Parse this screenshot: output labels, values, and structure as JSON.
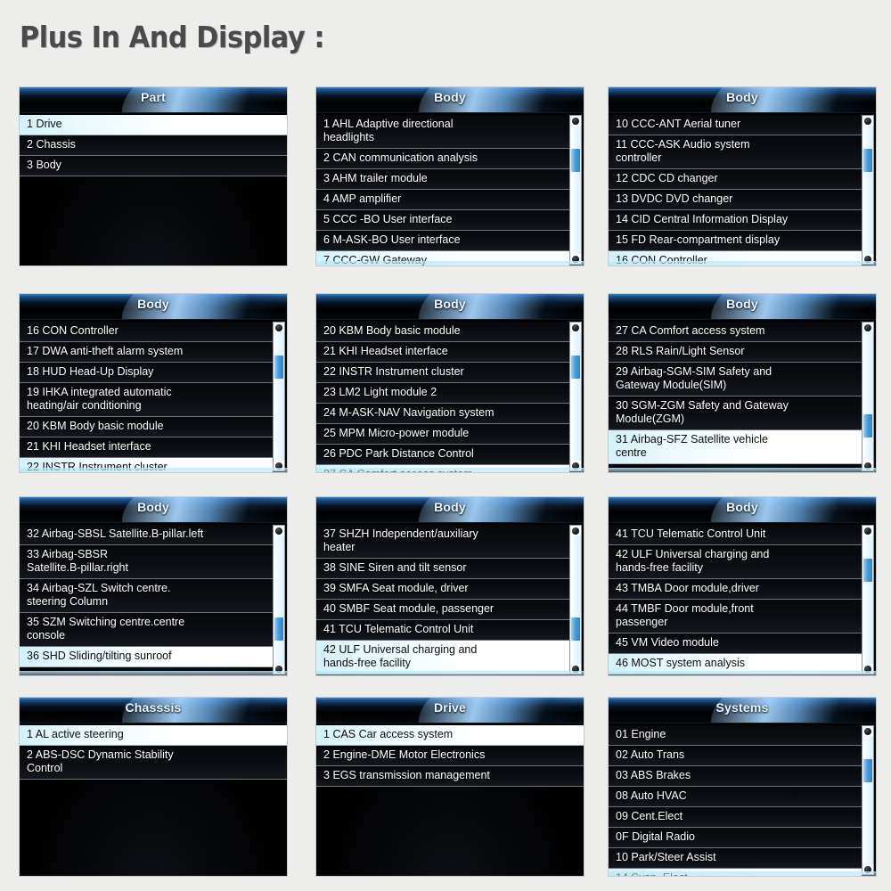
{
  "page": {
    "title": "Plus In And Display :",
    "background_color": "#ededec",
    "accent_color": "#4b9ede",
    "selected_row_color": "#e7f8fc",
    "header_glow_color": "#3d85c8"
  },
  "screens": [
    {
      "header": "Part",
      "scrollbar": {
        "visible": false,
        "thumb_top_pct": 0,
        "thumb_height_pct": 0
      },
      "bottom_sheen": false,
      "items": [
        {
          "num": "1",
          "label": "Drive",
          "selected": true
        },
        {
          "num": "2",
          "label": "Chassis",
          "selected": false
        },
        {
          "num": "3",
          "label": "Body",
          "selected": false
        }
      ]
    },
    {
      "header": "Body",
      "scrollbar": {
        "visible": true,
        "thumb_top_pct": 22,
        "thumb_height_pct": 16
      },
      "bottom_sheen": true,
      "items": [
        {
          "num": "1",
          "label": "AHL Adaptive directional\nheadlights",
          "selected": false
        },
        {
          "num": "2",
          "label": "CAN communication analysis",
          "selected": false
        },
        {
          "num": "3",
          "label": "AHM trailer module",
          "selected": false
        },
        {
          "num": "4",
          "label": "AMP amplifier",
          "selected": false
        },
        {
          "num": "5",
          "label": "CCC -BO User interface",
          "selected": false
        },
        {
          "num": "6",
          "label": "M-ASK-BO User interface",
          "selected": false
        },
        {
          "num": "7",
          "label": "CCC-GW Gateway",
          "selected": true
        }
      ]
    },
    {
      "header": "Body",
      "scrollbar": {
        "visible": true,
        "thumb_top_pct": 22,
        "thumb_height_pct": 16
      },
      "bottom_sheen": true,
      "items": [
        {
          "num": "10",
          "label": "CCC-ANT Aerial tuner",
          "selected": false
        },
        {
          "num": "11",
          "label": "CCC-ASK Audio system\ncontroller",
          "selected": false
        },
        {
          "num": "12",
          "label": "CDC CD changer",
          "selected": false
        },
        {
          "num": "13",
          "label": "DVDC DVD changer",
          "selected": false
        },
        {
          "num": "14",
          "label": "CID Central Information Display",
          "selected": false
        },
        {
          "num": "15",
          "label": "FD Rear-compartment display",
          "selected": false
        },
        {
          "num": "16",
          "label": "CON Controller",
          "selected": true
        }
      ]
    },
    {
      "header": "Body",
      "scrollbar": {
        "visible": true,
        "thumb_top_pct": 22,
        "thumb_height_pct": 16
      },
      "bottom_sheen": true,
      "items": [
        {
          "num": "16",
          "label": "CON Controller",
          "selected": false
        },
        {
          "num": "17",
          "label": "DWA anti-theft alarm system",
          "selected": false
        },
        {
          "num": "18",
          "label": "HUD Head-Up Display",
          "selected": false
        },
        {
          "num": "19",
          "label": "IHKA integrated automatic\nheating/air conditioning",
          "selected": false
        },
        {
          "num": "20",
          "label": "KBM Body basic module",
          "selected": false
        },
        {
          "num": "21",
          "label": "KHI Headset interface",
          "selected": false
        },
        {
          "num": "22",
          "label": "INSTR Instrument cluster",
          "selected": true
        }
      ]
    },
    {
      "header": "Body",
      "scrollbar": {
        "visible": true,
        "thumb_top_pct": 22,
        "thumb_height_pct": 16
      },
      "bottom_sheen": true,
      "items": [
        {
          "num": "20",
          "label": "KBM Body basic module",
          "selected": false
        },
        {
          "num": "21",
          "label": "KHI Headset interface",
          "selected": false
        },
        {
          "num": "22",
          "label": "INSTR Instrument cluster",
          "selected": false
        },
        {
          "num": "23",
          "label": "LM2 Light module 2",
          "selected": false
        },
        {
          "num": "24",
          "label": " M-ASK-NAV Navigation system",
          "selected": false
        },
        {
          "num": "25",
          "label": " MPM Micro-power module",
          "selected": false
        },
        {
          "num": "26",
          "label": " PDC Park Distance Control",
          "selected": false
        },
        {
          "num": "27",
          "label": "CA Comfort access system",
          "selected": true
        }
      ]
    },
    {
      "header": "Body",
      "scrollbar": {
        "visible": true,
        "thumb_top_pct": 62,
        "thumb_height_pct": 16
      },
      "bottom_sheen": true,
      "items": [
        {
          "num": "27",
          "label": "CA Comfort access system",
          "selected": false
        },
        {
          "num": "28",
          "label": "RLS Rain/Light Sensor",
          "selected": false
        },
        {
          "num": "29",
          "label": "Airbag-SGM-SIM Safety and\nGateway Module(SIM)",
          "selected": false
        },
        {
          "num": "30",
          "label": "SGM-ZGM Safety and Gateway\nModule(ZGM)",
          "selected": false
        },
        {
          "num": "31",
          "label": "Airbag-SFZ Satellite vehicle\ncentre",
          "selected": true
        }
      ]
    },
    {
      "header": "Body",
      "scrollbar": {
        "visible": true,
        "thumb_top_pct": 62,
        "thumb_height_pct": 16
      },
      "bottom_sheen": true,
      "items": [
        {
          "num": "32",
          "label": "Airbag-SBSL Satellite.B-pillar.left",
          "selected": false
        },
        {
          "num": "33",
          "label": "Airbag-SBSR\nSatellite.B-pillar.right",
          "selected": false
        },
        {
          "num": "34",
          "label": "Airbag-SZL Switch centre.\nsteering Column",
          "selected": false
        },
        {
          "num": "35",
          "label": "SZM Switching centre.centre\nconsole",
          "selected": false
        },
        {
          "num": "36",
          "label": "SHD Sliding/tilting sunroof",
          "selected": true
        }
      ]
    },
    {
      "header": "Body",
      "scrollbar": {
        "visible": true,
        "thumb_top_pct": 62,
        "thumb_height_pct": 16
      },
      "bottom_sheen": true,
      "items": [
        {
          "num": "37",
          "label": "SHZH Independent/auxiliary\nheater",
          "selected": false
        },
        {
          "num": "38",
          "label": "SINE Siren and tilt sensor",
          "selected": false
        },
        {
          "num": "39",
          "label": "SMFA  Seat module, driver",
          "selected": false
        },
        {
          "num": "40",
          "label": "SMBF  Seat module, passenger",
          "selected": false
        },
        {
          "num": "41",
          "label": "TCU Telematic Control Unit",
          "selected": false
        },
        {
          "num": "42",
          "label": "ULF Universal charging and\n  hands-free facility",
          "selected": true
        }
      ]
    },
    {
      "header": "Body",
      "scrollbar": {
        "visible": true,
        "thumb_top_pct": 22,
        "thumb_height_pct": 16
      },
      "bottom_sheen": true,
      "items": [
        {
          "num": "41",
          "label": "TCU Telematic Control Unit",
          "selected": false
        },
        {
          "num": "42",
          "label": "ULF  Universal charging and\nhands-free facility",
          "selected": false
        },
        {
          "num": "43",
          "label": "TMBA Door module,driver",
          "selected": false
        },
        {
          "num": "44",
          "label": "TMBF  Door module,front\npassenger",
          "selected": false
        },
        {
          "num": "45",
          "label": "VM Video module",
          "selected": false
        },
        {
          "num": "46",
          "label": "MOST system analysis",
          "selected": true
        }
      ]
    },
    {
      "header": "Chasssis",
      "scrollbar": {
        "visible": false,
        "thumb_top_pct": 0,
        "thumb_height_pct": 0
      },
      "bottom_sheen": false,
      "items": [
        {
          "num": "1",
          "label": "AL active steering",
          "selected": true
        },
        {
          "num": "2",
          "label": "ABS-DSC Dynamic Stability\nControl",
          "selected": false
        }
      ]
    },
    {
      "header": "Drive",
      "scrollbar": {
        "visible": false,
        "thumb_top_pct": 0,
        "thumb_height_pct": 0
      },
      "bottom_sheen": false,
      "items": [
        {
          "num": "1",
          "label": "CAS Car access system",
          "selected": true
        },
        {
          "num": "2",
          "label": "Engine-DME Motor Electronics",
          "selected": false
        },
        {
          "num": "3",
          "label": "EGS transmission management",
          "selected": false
        }
      ]
    },
    {
      "header": "Systems",
      "scrollbar": {
        "visible": true,
        "thumb_top_pct": 22,
        "thumb_height_pct": 16
      },
      "bottom_sheen": true,
      "items": [
        {
          "num": "01",
          "label": "Engine",
          "selected": false
        },
        {
          "num": "02",
          "label": "Auto Trans",
          "selected": false
        },
        {
          "num": "03",
          "label": "ABS Brakes",
          "selected": false
        },
        {
          "num": "08",
          "label": "Auto HVAC",
          "selected": false
        },
        {
          "num": "09",
          "label": "Cent.Elect",
          "selected": false
        },
        {
          "num": "0F",
          "label": " Digital Radio",
          "selected": false
        },
        {
          "num": "10",
          "label": " Park/Steer Assist",
          "selected": false
        },
        {
          "num": "14",
          "label": "Susp .Elect.",
          "selected": true
        }
      ]
    }
  ],
  "grid": {
    "columns_x": [
      22,
      355,
      683
    ],
    "rows_y": [
      98,
      330,
      558,
      783
    ]
  }
}
